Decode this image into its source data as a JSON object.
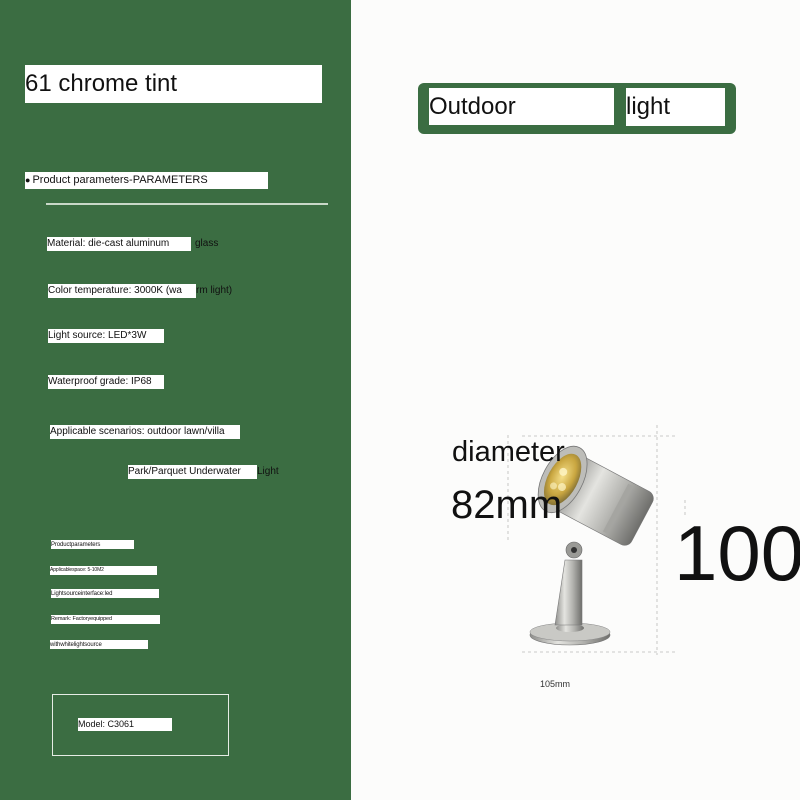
{
  "title": "61 chrome tint",
  "section_heading": "Product parameters-PARAMETERS",
  "bullet_glyph": "●",
  "params": {
    "material": "Material: die-cast aluminum",
    "material_tail": "glass",
    "color_temp": "Color temperature: 3000K (wa",
    "color_temp_tail": "rm light)",
    "light_source": "Light source: LED*3W",
    "waterproof": "Waterproof grade: IP68",
    "scenarios": "Applicable scenarios: outdoor lawn/villa",
    "scenarios_line2": "Park/Parquet Underwater",
    "scenarios_line2_tail": "Light"
  },
  "small_params": {
    "line1": "Productparameters",
    "line2": "Applicablespace: 5-10M2",
    "line3": "Lightsourceinterface:led",
    "line4": "Remark: Factoryequipped",
    "line5": "withwhitelightsource"
  },
  "model": "Model: C3061",
  "banner": {
    "part1": "Outdoor",
    "part2": "light"
  },
  "dimensions": {
    "diameter_label": "diameter",
    "diameter_value": "82mm",
    "height_value": "100",
    "width_value": "105mm"
  },
  "colors": {
    "green": "#3b6d42",
    "white": "#ffffff",
    "background": "#fbfbfa"
  },
  "icons": {
    "product": "spotlight-lamp"
  }
}
